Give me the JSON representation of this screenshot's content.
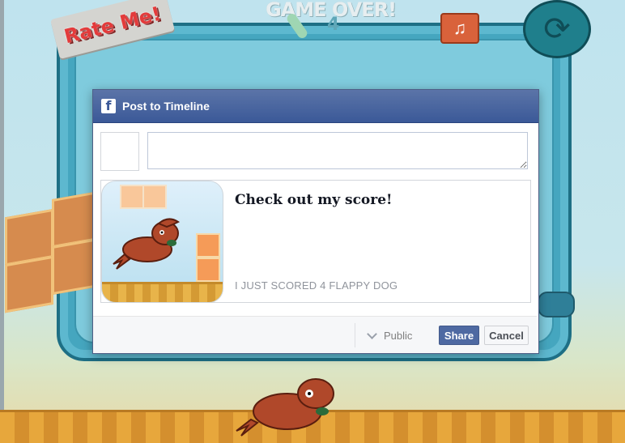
{
  "game": {
    "rate_me_label": "Rate Me!",
    "game_over_title": "GAME OVER!",
    "score_value": "4",
    "music_icon": "music-note-icon",
    "replay_icon": "replay-icon"
  },
  "dialog": {
    "title": "Post to Timeline",
    "logo_letter": "f",
    "message_placeholder": "",
    "story": {
      "title": "Check out my score!",
      "caption": "I JUST SCORED 4 FLAPPY DOG"
    },
    "footer": {
      "privacy_label": "Public",
      "share_label": "Share",
      "cancel_label": "Cancel"
    }
  },
  "colors": {
    "facebook_blue": "#3b5998",
    "share_button": "#4e69a2",
    "game_panel": "#45a6bf",
    "dog_brown": "#b0482a"
  }
}
